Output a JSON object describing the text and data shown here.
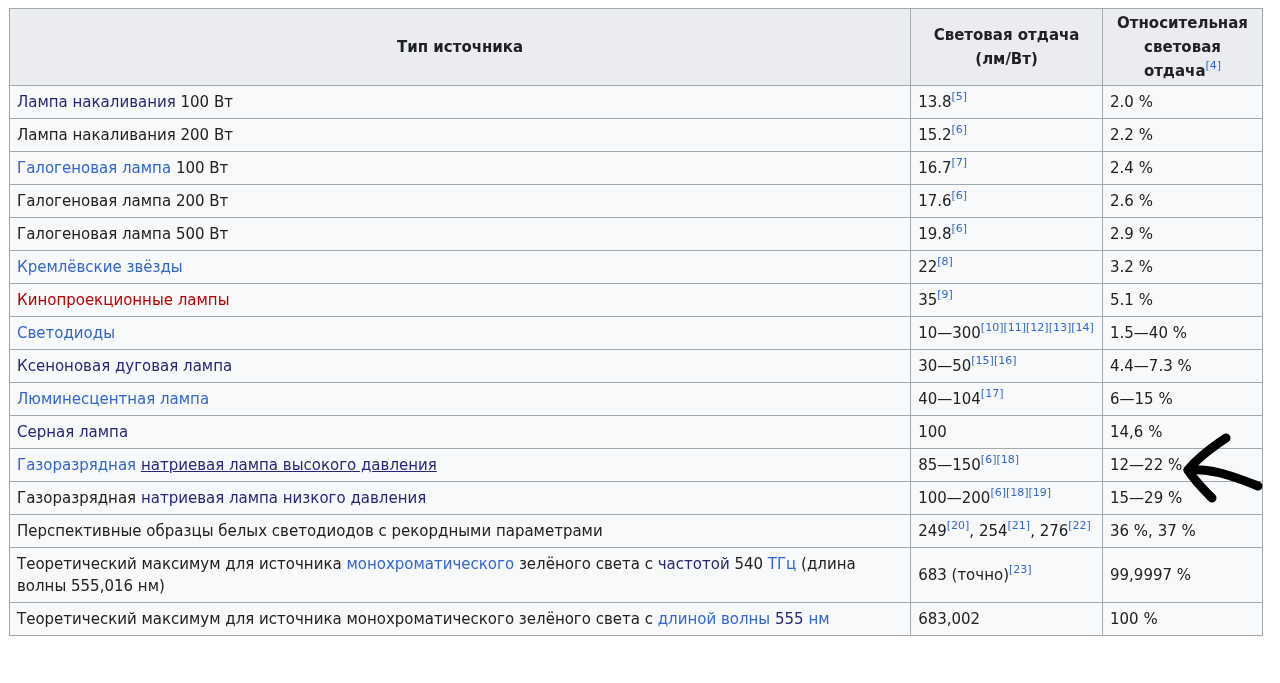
{
  "table": {
    "columns": [
      {
        "parts": [
          {
            "text": "Тип источника",
            "kind": "plain"
          }
        ]
      },
      {
        "parts": [
          {
            "text": "Световая отдача (лм/Вт)",
            "kind": "plain"
          }
        ]
      },
      {
        "parts": [
          {
            "text": "Относительная световая отдача",
            "kind": "plain"
          },
          {
            "text": "[4]",
            "kind": "ref"
          }
        ]
      }
    ],
    "rows": [
      {
        "cells": [
          {
            "parts": [
              {
                "text": "Лампа накаливания",
                "kind": "visited"
              },
              {
                "text": " 100 Вт",
                "kind": "plain"
              }
            ]
          },
          {
            "parts": [
              {
                "text": "13.8",
                "kind": "plain"
              },
              {
                "text": "[5]",
                "kind": "ref"
              }
            ]
          },
          {
            "parts": [
              {
                "text": "2.0 %",
                "kind": "plain"
              }
            ]
          }
        ]
      },
      {
        "cells": [
          {
            "parts": [
              {
                "text": "Лампа накаливания 200 Вт",
                "kind": "plain"
              }
            ]
          },
          {
            "parts": [
              {
                "text": "15.2",
                "kind": "plain"
              },
              {
                "text": "[6]",
                "kind": "ref"
              }
            ]
          },
          {
            "parts": [
              {
                "text": "2.2 %",
                "kind": "plain"
              }
            ]
          }
        ]
      },
      {
        "cells": [
          {
            "parts": [
              {
                "text": "Галогеновая лампа",
                "kind": "link"
              },
              {
                "text": " 100 Вт",
                "kind": "plain"
              }
            ]
          },
          {
            "parts": [
              {
                "text": "16.7",
                "kind": "plain"
              },
              {
                "text": "[7]",
                "kind": "ref"
              }
            ]
          },
          {
            "parts": [
              {
                "text": "2.4 %",
                "kind": "plain"
              }
            ]
          }
        ]
      },
      {
        "cells": [
          {
            "parts": [
              {
                "text": "Галогеновая лампа 200 Вт",
                "kind": "plain"
              }
            ]
          },
          {
            "parts": [
              {
                "text": "17.6",
                "kind": "plain"
              },
              {
                "text": "[6]",
                "kind": "ref"
              }
            ]
          },
          {
            "parts": [
              {
                "text": "2.6 %",
                "kind": "plain"
              }
            ]
          }
        ]
      },
      {
        "cells": [
          {
            "parts": [
              {
                "text": "Галогеновая лампа 500 Вт",
                "kind": "plain"
              }
            ]
          },
          {
            "parts": [
              {
                "text": "19.8",
                "kind": "plain"
              },
              {
                "text": "[6]",
                "kind": "ref"
              }
            ]
          },
          {
            "parts": [
              {
                "text": "2.9 %",
                "kind": "plain"
              }
            ]
          }
        ]
      },
      {
        "cells": [
          {
            "parts": [
              {
                "text": "Кремлёвские звёзды",
                "kind": "link"
              }
            ]
          },
          {
            "parts": [
              {
                "text": "22",
                "kind": "plain"
              },
              {
                "text": "[8]",
                "kind": "ref"
              }
            ]
          },
          {
            "parts": [
              {
                "text": "3.2 %",
                "kind": "plain"
              }
            ]
          }
        ]
      },
      {
        "cells": [
          {
            "parts": [
              {
                "text": "Кинопроекционные лампы",
                "kind": "redlink"
              }
            ]
          },
          {
            "parts": [
              {
                "text": "35",
                "kind": "plain"
              },
              {
                "text": "[9]",
                "kind": "ref"
              }
            ]
          },
          {
            "parts": [
              {
                "text": "5.1 %",
                "kind": "plain"
              }
            ]
          }
        ]
      },
      {
        "cells": [
          {
            "parts": [
              {
                "text": "Светодиоды",
                "kind": "link"
              }
            ]
          },
          {
            "parts": [
              {
                "text": "10—300",
                "kind": "plain"
              },
              {
                "text": "[10]",
                "kind": "ref"
              },
              {
                "text": "[11]",
                "kind": "ref"
              },
              {
                "text": "[12]",
                "kind": "ref"
              },
              {
                "text": "[13]",
                "kind": "ref"
              },
              {
                "text": "[14]",
                "kind": "ref"
              }
            ]
          },
          {
            "parts": [
              {
                "text": "1.5—40 %",
                "kind": "plain"
              }
            ]
          }
        ]
      },
      {
        "cells": [
          {
            "parts": [
              {
                "text": "Ксеноновая дуговая лампа",
                "kind": "visited"
              }
            ]
          },
          {
            "parts": [
              {
                "text": "30—50",
                "kind": "plain"
              },
              {
                "text": "[15]",
                "kind": "ref"
              },
              {
                "text": "[16]",
                "kind": "ref"
              }
            ]
          },
          {
            "parts": [
              {
                "text": "4.4—7.3 %",
                "kind": "plain"
              }
            ]
          }
        ]
      },
      {
        "cells": [
          {
            "parts": [
              {
                "text": "Люминесцентная лампа",
                "kind": "link"
              }
            ]
          },
          {
            "parts": [
              {
                "text": "40—104",
                "kind": "plain"
              },
              {
                "text": "[17]",
                "kind": "ref"
              }
            ]
          },
          {
            "parts": [
              {
                "text": "6—15 %",
                "kind": "plain"
              }
            ]
          }
        ]
      },
      {
        "cells": [
          {
            "parts": [
              {
                "text": "Серная лампа",
                "kind": "visited"
              }
            ]
          },
          {
            "parts": [
              {
                "text": "100",
                "kind": "plain"
              }
            ]
          },
          {
            "parts": [
              {
                "text": "14,6 %",
                "kind": "plain"
              }
            ]
          }
        ]
      },
      {
        "cells": [
          {
            "parts": [
              {
                "text": "Газоразрядная",
                "kind": "link"
              },
              {
                "text": "натриевая лампа высокого давления",
                "kind": "hovered"
              }
            ]
          },
          {
            "parts": [
              {
                "text": "85—150",
                "kind": "plain"
              },
              {
                "text": "[6]",
                "kind": "ref"
              },
              {
                "text": "[18]",
                "kind": "ref"
              }
            ]
          },
          {
            "parts": [
              {
                "text": "12—22 %",
                "kind": "plain"
              }
            ]
          }
        ]
      },
      {
        "cells": [
          {
            "parts": [
              {
                "text": "Газоразрядная ",
                "kind": "plain"
              },
              {
                "text": "натриевая лампа низкого давления",
                "kind": "visited"
              }
            ]
          },
          {
            "parts": [
              {
                "text": "100—200",
                "kind": "plain"
              },
              {
                "text": "[6]",
                "kind": "ref"
              },
              {
                "text": "[18]",
                "kind": "ref"
              },
              {
                "text": "[19]",
                "kind": "ref"
              }
            ]
          },
          {
            "parts": [
              {
                "text": "15—29 %",
                "kind": "plain"
              }
            ]
          }
        ]
      },
      {
        "cells": [
          {
            "parts": [
              {
                "text": "Перспективные образцы белых светодиодов с рекордными параметрами",
                "kind": "plain"
              }
            ]
          },
          {
            "parts": [
              {
                "text": "249",
                "kind": "plain"
              },
              {
                "text": "[20]",
                "kind": "ref"
              },
              {
                "text": ", 254",
                "kind": "plain"
              },
              {
                "text": "[21]",
                "kind": "ref"
              },
              {
                "text": ", 276",
                "kind": "plain"
              },
              {
                "text": "[22]",
                "kind": "ref"
              }
            ]
          },
          {
            "parts": [
              {
                "text": "36 %, 37 %",
                "kind": "plain"
              }
            ]
          }
        ]
      },
      {
        "cells": [
          {
            "parts": [
              {
                "text": "Теоретический максимум для источника ",
                "kind": "plain"
              },
              {
                "text": "монохроматического",
                "kind": "link"
              },
              {
                "text": " зелёного света с ",
                "kind": "plain"
              },
              {
                "text": "частотой",
                "kind": "visited"
              },
              {
                "text": " 540 ",
                "kind": "plain"
              },
              {
                "text": "ТГц",
                "kind": "link"
              },
              {
                "text": " (длина волны 555,016 нм)",
                "kind": "plain"
              }
            ]
          },
          {
            "parts": [
              {
                "text": "683 (точно)",
                "kind": "plain"
              },
              {
                "text": "[23]",
                "kind": "ref"
              }
            ]
          },
          {
            "parts": [
              {
                "text": "99,9997 %",
                "kind": "plain"
              }
            ]
          }
        ]
      },
      {
        "cells": [
          {
            "parts": [
              {
                "text": "Теоретический максимум для источника монохроматического зелёного света с ",
                "kind": "plain"
              },
              {
                "text": "длиной волны",
                "kind": "link"
              },
              {
                "text": "555",
                "kind": "visited"
              },
              {
                "text": "нм",
                "kind": "link"
              }
            ]
          },
          {
            "parts": [
              {
                "text": "683,002",
                "kind": "plain"
              }
            ]
          },
          {
            "parts": [
              {
                "text": "100 %",
                "kind": "plain"
              }
            ]
          }
        ]
      }
    ]
  }
}
